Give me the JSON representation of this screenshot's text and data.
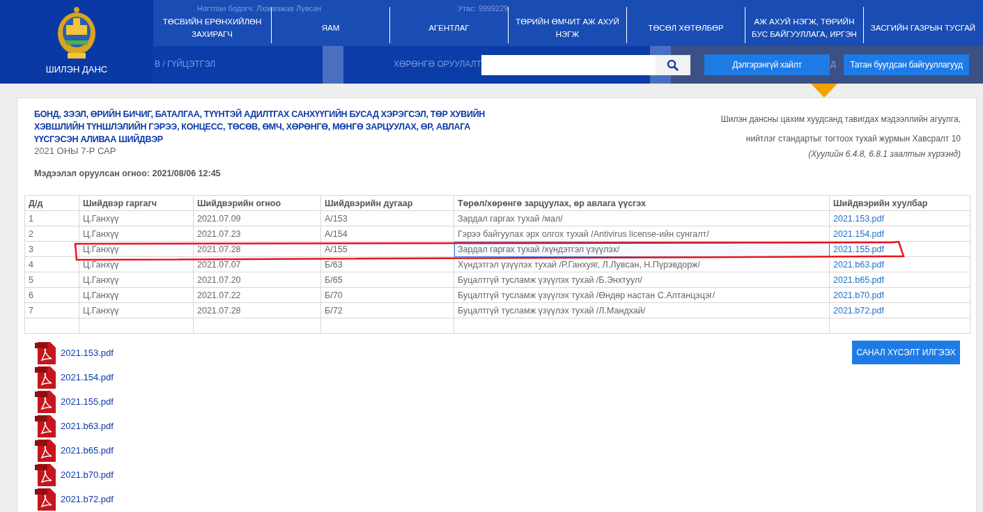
{
  "header": {
    "logo_title": "ШИЛЭН ДАНС",
    "nav": [
      "ТӨСВИЙН ЕРӨНХИЙЛӨН ЗАХИРАГЧ",
      "ЯАМ",
      "АГЕНТЛАГ",
      "ТӨРИЙН ӨМЧИТ АЖ АХУЙ НЭГЖ",
      "ТӨСӨЛ ХӨТӨЛБӨР",
      "АЖ АХУЙ НЭГЖ, ТӨРИЙН БУС БАЙГУУЛЛАГА, ИРГЭН",
      "ЗАСГИЙН ГАЗРЫН ТУСГАЙ"
    ],
    "background_texts": [
      "Нягтлан бодогч: Лхагважав Лувсан",
      "Утас: 9999229",
      "В / ГҮЙЦЭТГЭЛ",
      "ХӨРӨНГӨ ОРУУЛАЛТ",
      "Д"
    ],
    "buttons": [
      "Дэлгэрэнгүй хайлт",
      "Татан буугдсан байгууллагууд"
    ]
  },
  "document": {
    "title": "БОНД, ЗЭЭЛ, ӨРИЙН БИЧИГ, БАТАЛГАА, ТҮҮНТЭЙ АДИЛТГАХ САНХҮҮГИЙН БУСАД ХЭРЭГСЭЛ, ТӨР ХУВИЙН ХЭВШЛИЙН ТҮНШЛЭЛИЙН ГЭРЭЭ, КОНЦЕСС, ТӨСӨВ, ӨМЧ, ХӨРӨНГӨ, МӨНГӨ ЗАРЦУУЛАХ, ӨР, АВЛАГА ҮҮСГЭСЭН АЛИВАА ШИЙДВЭР",
    "period": "2021 ОНЫ 7-Р САР",
    "uploaded": "Мэдээлэл оруулсан огноо: 2021/08/06 12:45",
    "legal_note": [
      "Шилэн дансны цахим хуудсанд тавигдах мэдээллийн агуулга,",
      "нийтлэг стандартыг тогтоох тухай журмын Хавсралт 10"
    ],
    "legal_ref": "(Хуулийн 6.4.8, 6.8.1 заалтын хүрээнд)"
  },
  "table": {
    "columns": [
      "Д/д",
      "Шийдвэр гаргагч",
      "Шийдвэрийн огноо",
      "Шийдвэрийн дугаар",
      "Төрөл/хөрөнгө зарцуулах, өр авлага үүсгэх",
      "Шийдвэрийн хуулбар"
    ],
    "rows": [
      {
        "cells": [
          "1",
          "Ц.Ганхүү",
          "2021.07.09",
          "А/153",
          "Зардал гаргах тухай /мал/"
        ],
        "file": "2021.153.pdf",
        "selected": false
      },
      {
        "cells": [
          "2",
          "Ц.Ганхүү",
          "2021.07.23",
          "А/154",
          "Гэрээ байгуулах эрх олгох тухай /Antivirus license-ийн сунгалт/"
        ],
        "file": "2021.154.pdf",
        "selected": false
      },
      {
        "cells": [
          "3",
          "Ц.Ганхүү",
          "2021.07.28",
          "А/155",
          "Зардал гаргах тухай /хүндэтгэл үзүүлэх/"
        ],
        "file": "2021.155.pdf",
        "selected": true
      },
      {
        "cells": [
          "4",
          "Ц.Ганхүү",
          "2021.07.07",
          "Б/63",
          "Хүндэтгэл үзүүлэх тухай /Р.Ганхуяг, Л.Лувсан, Н.Пүрэвдорж/"
        ],
        "file": "2021.b63.pdf",
        "selected": false
      },
      {
        "cells": [
          "5",
          "Ц.Ганхүү",
          "2021.07.20",
          "Б/65",
          "Буцалтгүй тусламж үзүүлэх тухай /Б.Энхтуул/"
        ],
        "file": "2021.b65.pdf",
        "selected": false
      },
      {
        "cells": [
          "6",
          "Ц.Ганхүү",
          "2021.07.22",
          "Б/70",
          "Буцалтгүй тусламж үзүүлэх тухай /Өндөр настан С.Алтанцэцэг/"
        ],
        "file": "2021.b70.pdf",
        "selected": false
      },
      {
        "cells": [
          "7",
          "Ц.Ганхүү",
          "2021.07.28",
          "Б/72",
          "Буцалтгүй тусламж үзүүлэх тухай /Л.Мандхай/"
        ],
        "file": "2021.b72.pdf",
        "selected": false
      }
    ]
  },
  "files": [
    "2021.153.pdf",
    "2021.154.pdf",
    "2021.155.pdf",
    "2021.b63.pdf",
    "2021.b65.pdf",
    "2021.b70.pdf",
    "2021.b72.pdf"
  ],
  "feedback_button": "САНАЛ ХҮСЭЛТ ИЛГЭЭХ"
}
